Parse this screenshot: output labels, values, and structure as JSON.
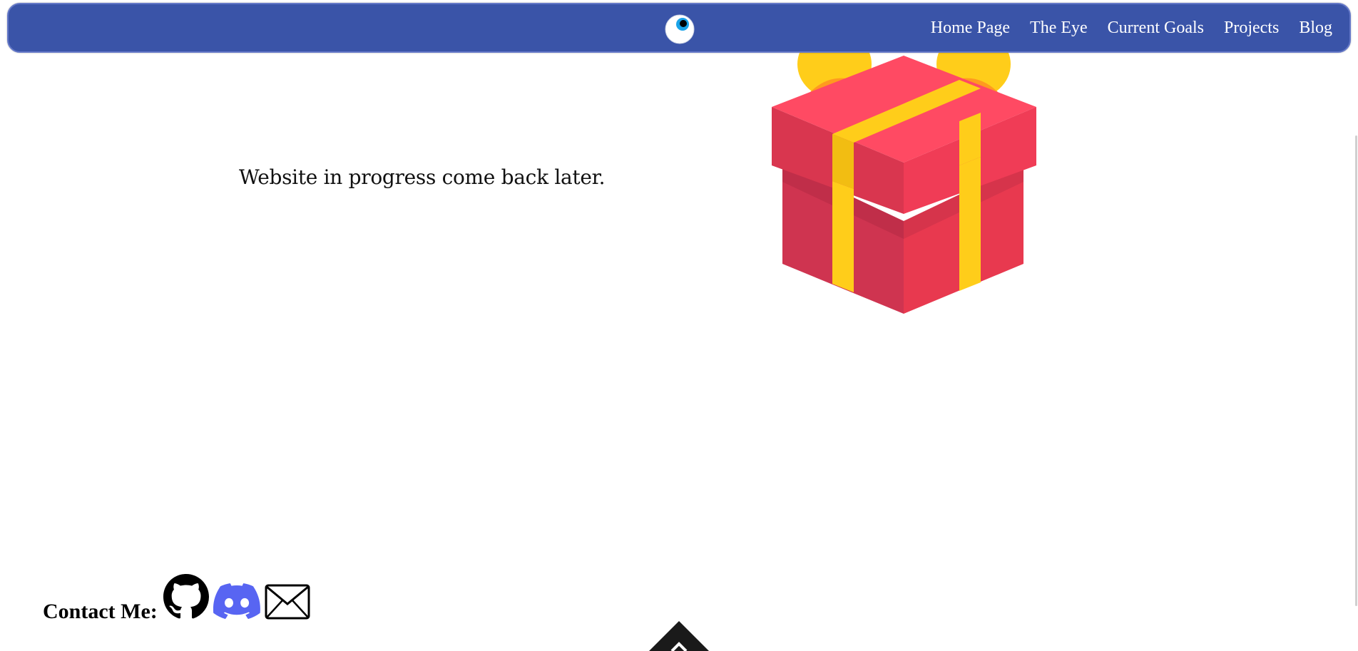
{
  "nav": {
    "logo_icon": "eye-icon",
    "links": [
      {
        "label": "Home Page"
      },
      {
        "label": "The Eye"
      },
      {
        "label": "Current Goals"
      },
      {
        "label": "Projects"
      },
      {
        "label": "Blog"
      }
    ]
  },
  "main": {
    "message": "Website in progress come back later.",
    "image_icon": "gift-box-icon"
  },
  "footer": {
    "contact_label": "Contact Me:",
    "icons": [
      "github-icon",
      "discord-icon",
      "email-icon"
    ],
    "back_to_top_icon": "arrow-up-icon"
  },
  "colors": {
    "nav_bg": "#3a54a8",
    "nav_border": "#6478c8",
    "discord": "#5865f2",
    "gift_red": "#e8394f",
    "gift_ribbon": "#ffcd1a"
  }
}
